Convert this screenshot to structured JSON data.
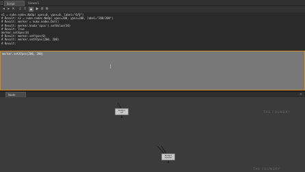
{
  "tabs": {
    "script_editor": "Script Editor",
    "viewer": "Viewer1"
  },
  "output_lines": [
    "n1 = nuke.nodes.NoOp( xpos=0, ypos=0, label=\"0/0\")",
    "# Result: n2 = nuke.nodes.NoOp( xpos=200, ypos=200, label=\"200/200\")",
    "# Result: merker = nuke.nodes.Dot()",
    "# Result: merker.knob('xpos').setValue(50)",
    "# Result: True",
    "merker.setXpos(0)",
    "# Result: merker.setYpos(0)",
    "# Result: merker.setXYpos(200, 200)",
    "# Result:"
  ],
  "input_text": "merker.setXYpos(200, 200)",
  "node_graph": {
    "tab_label": "Node Graph",
    "nodes": [
      {
        "name": "NoOp1",
        "label": "0/0"
      },
      {
        "name": "NoOp2",
        "label": "200/200"
      }
    ]
  },
  "watermark": "THE FOUNDRY",
  "colors": {
    "accent": "#d58a1e",
    "input_bg": "#787878",
    "output_bg": "#2a2a2a"
  }
}
